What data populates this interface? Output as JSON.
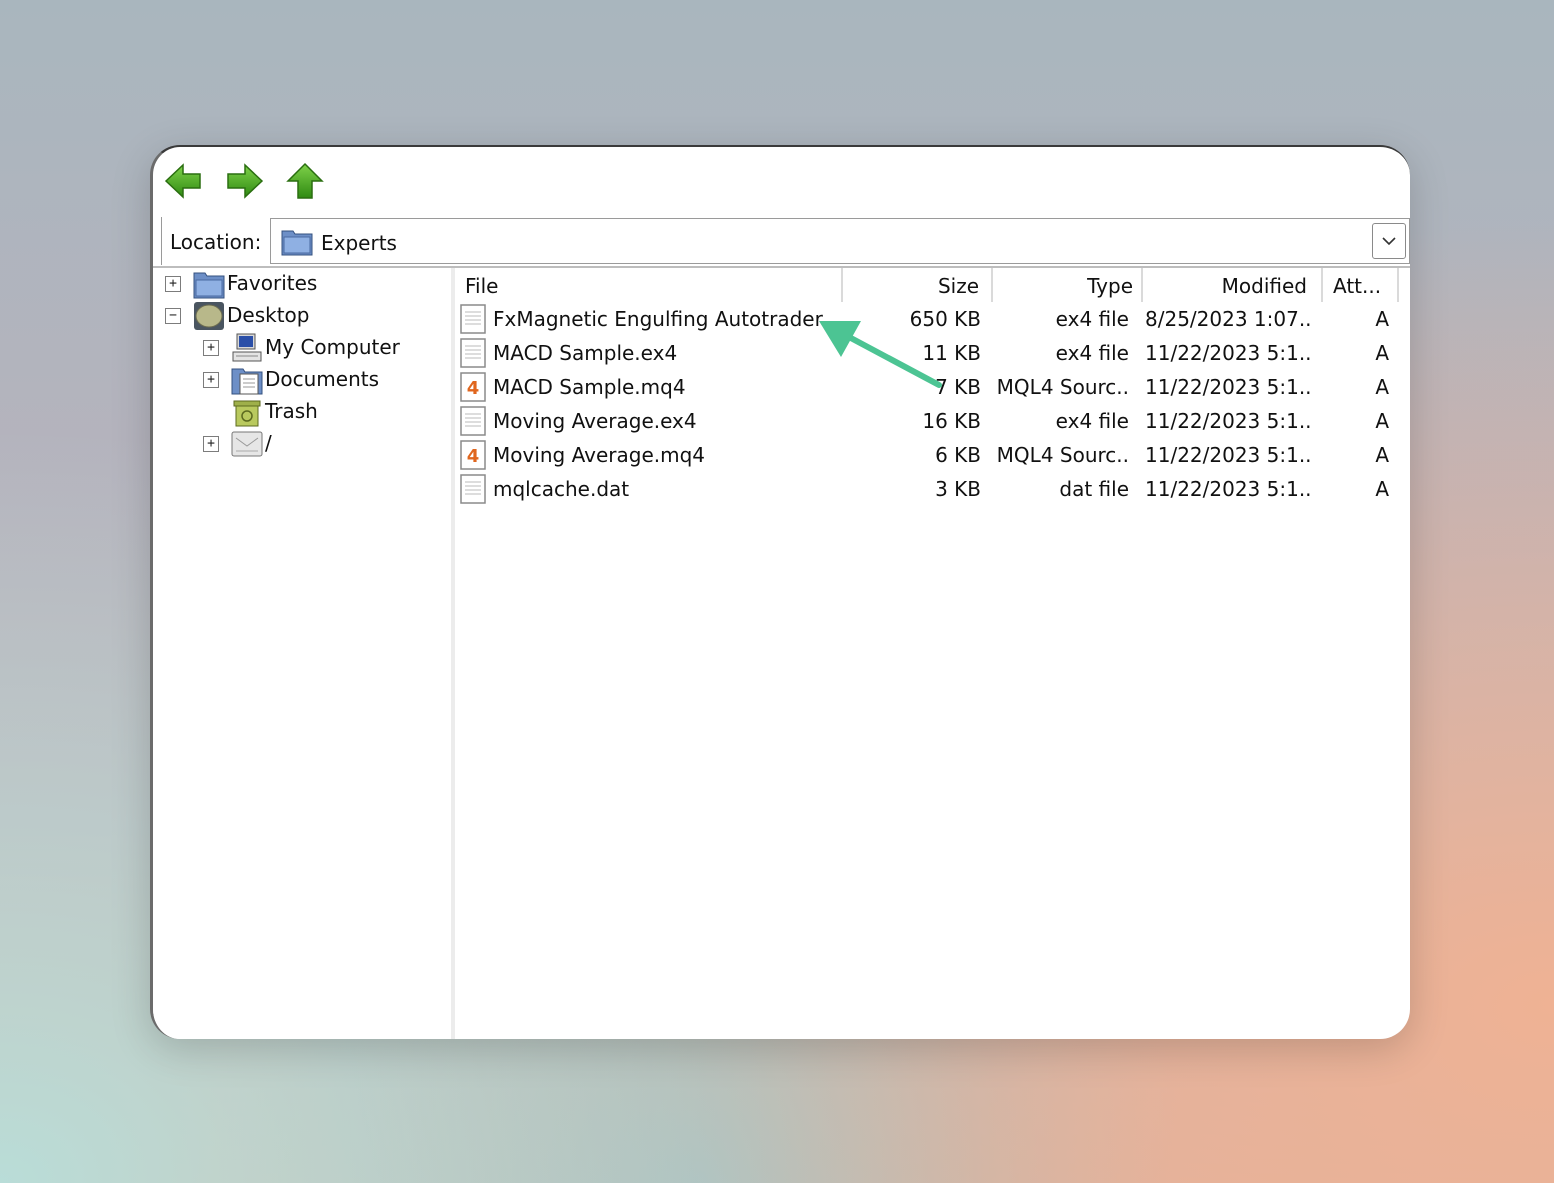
{
  "toolbar": {
    "back_icon": "back-arrow-icon",
    "forward_icon": "forward-arrow-icon",
    "up_icon": "up-arrow-icon",
    "icon_color": "#3aa21a"
  },
  "location": {
    "label": "Location:",
    "value": "Experts"
  },
  "tree": [
    {
      "label": "Favorites",
      "expander": "+"
    },
    {
      "label": "Desktop",
      "expander": "−"
    },
    {
      "label": "My Computer",
      "expander": "+"
    },
    {
      "label": "Documents",
      "expander": "+"
    },
    {
      "label": "Trash",
      "expander": ""
    },
    {
      "label": "/",
      "expander": "+"
    }
  ],
  "columns": {
    "file": "File",
    "size": "Size",
    "type": "Type",
    "modified": "Modified",
    "attr": "Att..."
  },
  "files": [
    {
      "name": "FxMagnetic Engulfing Autotrader",
      "size": "650 KB",
      "type": "ex4 file",
      "modified": "8/25/2023 1:07..",
      "attr": "A",
      "icon": "text-document-icon"
    },
    {
      "name": "MACD Sample.ex4",
      "size": "11 KB",
      "type": "ex4 file",
      "modified": "11/22/2023 5:1..",
      "attr": "A",
      "icon": "text-document-icon"
    },
    {
      "name": "MACD Sample.mq4",
      "size": "7 KB",
      "type": "MQL4 Sourc..",
      "modified": "11/22/2023 5:1..",
      "attr": "A",
      "icon": "mq4-source-icon"
    },
    {
      "name": "Moving Average.ex4",
      "size": "16 KB",
      "type": "ex4 file",
      "modified": "11/22/2023 5:1..",
      "attr": "A",
      "icon": "text-document-icon"
    },
    {
      "name": "Moving Average.mq4",
      "size": "6 KB",
      "type": "MQL4 Sourc..",
      "modified": "11/22/2023 5:1..",
      "attr": "A",
      "icon": "mq4-source-icon"
    },
    {
      "name": "mqlcache.dat",
      "size": "3 KB",
      "type": "dat file",
      "modified": "11/22/2023 5:1..",
      "attr": "A",
      "icon": "text-document-icon"
    }
  ],
  "annotation": {
    "arrow_color": "#4cc493"
  }
}
